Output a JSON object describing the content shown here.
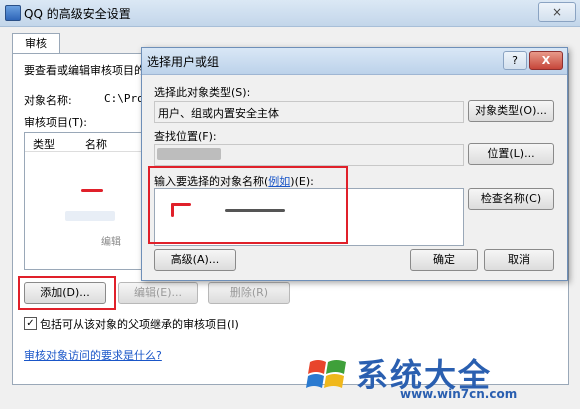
{
  "outer": {
    "title": "QQ 的高级安全设置",
    "close_label": "×",
    "tab_label": "审核",
    "instruction": "要查看或编辑审核项目的详细信息，请选择该项目并单击“编辑”",
    "object_name_label": "对象名称:",
    "object_name_value": "C:\\Pro",
    "audit_items_label": "审核项目(T):",
    "col_type": "类型",
    "col_name": "名称",
    "edit_hint": "编辑",
    "add_button": "添加(D)...",
    "edit_button": "编辑(E)...",
    "delete_button": "删除(R)",
    "inherit_checkbox_label": "包括可从该对象的父项继承的审核项目(I)",
    "inherit_checked": true,
    "help_link": "审核对象访问的要求是什么?"
  },
  "dialog": {
    "title": "选择用户或组",
    "help_label": "?",
    "close_label": "X",
    "object_type_label": "选择此对象类型(S):",
    "object_type_value": "用户、组或内置安全主体",
    "object_type_button": "对象类型(O)...",
    "location_label": "查找位置(F):",
    "location_button": "位置(L)...",
    "enter_names_label": "输入要选择的对象名称(",
    "example_link": "例如",
    "enter_names_suffix": ")(E):",
    "check_names_button": "检查名称(C)",
    "advanced_button": "高级(A)...",
    "ok_button": "确定",
    "cancel_button": "取消"
  },
  "watermark": {
    "brand": "系统大全",
    "url": "www.win7cn.com"
  },
  "colors": {
    "highlight_red": "#e0202a",
    "link_blue": "#1a56c8",
    "brand_blue": "#2a5fb0"
  }
}
